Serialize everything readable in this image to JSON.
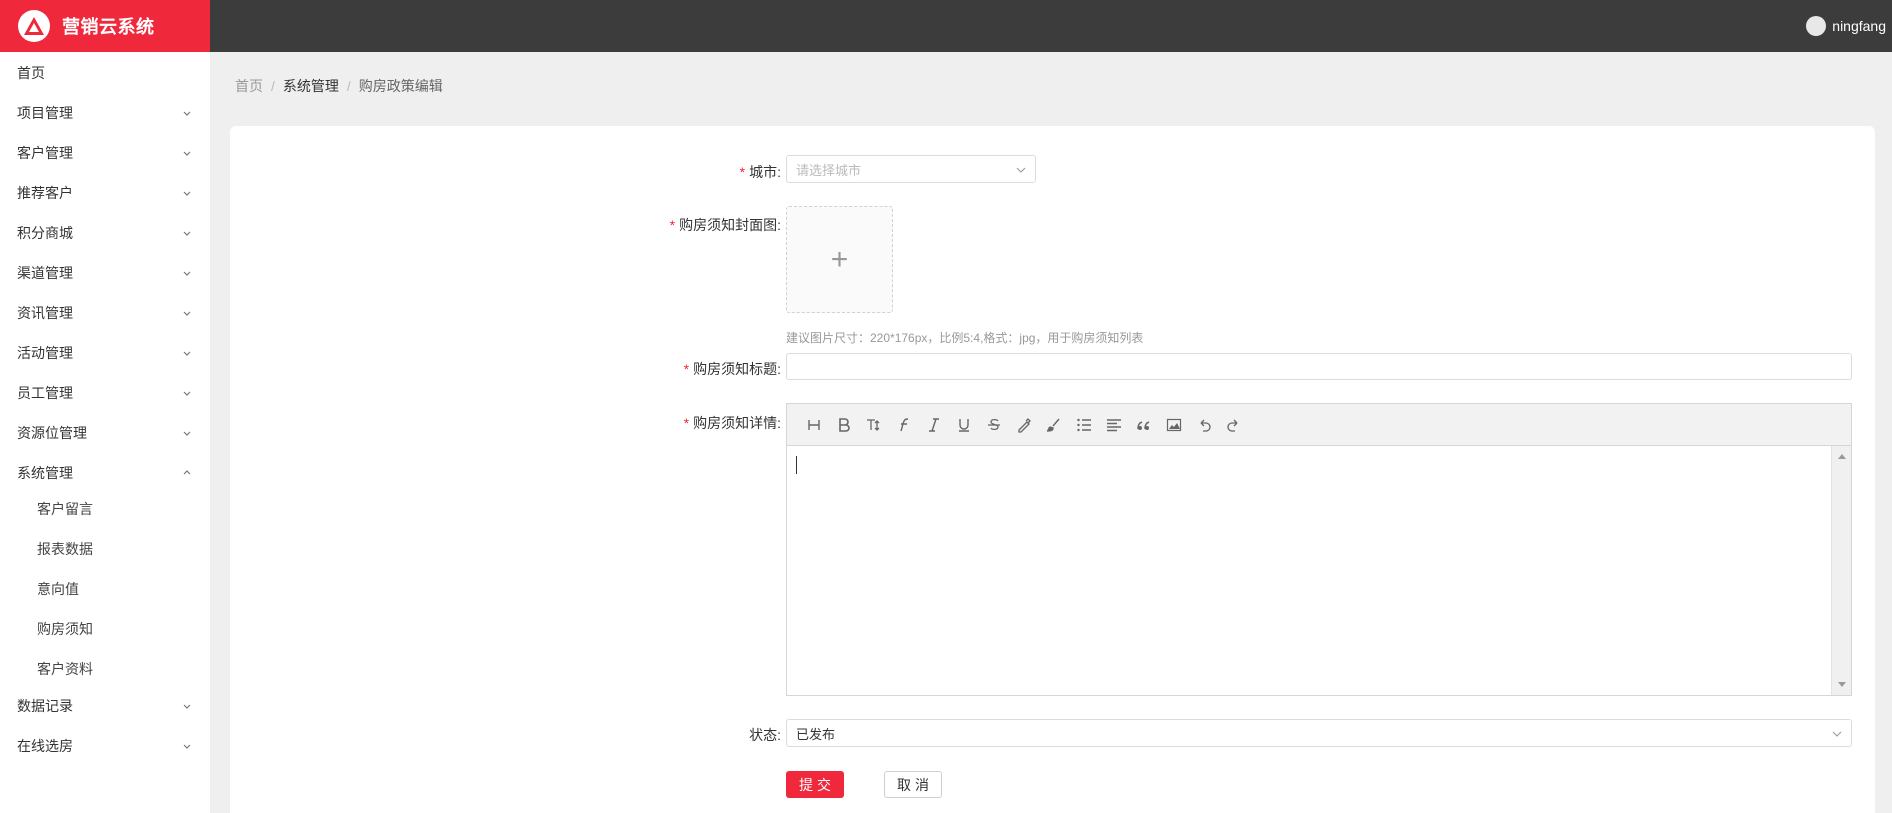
{
  "app": {
    "title": "营销云系统",
    "brand_color": "#f0283c",
    "topbar_color": "#3b3c3b",
    "user": "ningfang"
  },
  "sidebar": {
    "items": [
      {
        "label": "首页",
        "expandable": false
      },
      {
        "label": "项目管理",
        "expandable": true
      },
      {
        "label": "客户管理",
        "expandable": true
      },
      {
        "label": "推荐客户",
        "expandable": true
      },
      {
        "label": "积分商城",
        "expandable": true
      },
      {
        "label": "渠道管理",
        "expandable": true
      },
      {
        "label": "资讯管理",
        "expandable": true
      },
      {
        "label": "活动管理",
        "expandable": true
      },
      {
        "label": "员工管理",
        "expandable": true
      },
      {
        "label": "资源位管理",
        "expandable": true
      },
      {
        "label": "系统管理",
        "expandable": true,
        "expanded": true,
        "children": [
          "客户留言",
          "报表数据",
          "意向值",
          "购房须知",
          "客户资料"
        ]
      },
      {
        "label": "数据记录",
        "expandable": true
      },
      {
        "label": "在线选房",
        "expandable": true
      }
    ]
  },
  "breadcrumb": [
    "首页",
    "系统管理",
    "购房政策编辑"
  ],
  "breadcrumb_sep": "/",
  "form": {
    "required_mark": "*",
    "city": {
      "label": "城市:",
      "placeholder": "请选择城市"
    },
    "cover": {
      "label": "购房须知封面图:",
      "plus": "+",
      "hint": "建议图片尺寸：220*176px，比例5:4,格式：jpg，用于购房须知列表"
    },
    "title": {
      "label": "购房须知标题:",
      "value": ""
    },
    "detail": {
      "label": "购房须知详情:",
      "toolbar": [
        "heading-icon",
        "bold-icon",
        "font-size-icon",
        "font-family-icon",
        "italic-icon",
        "underline-icon",
        "strikethrough-icon",
        "text-color-icon",
        "background-color-icon",
        "list-icon",
        "align-icon",
        "quote-icon",
        "image-icon",
        "undo-icon",
        "redo-icon"
      ]
    },
    "status": {
      "label": "状态:",
      "value": "已发布"
    },
    "submit_label": "提交",
    "cancel_label": "取消"
  }
}
